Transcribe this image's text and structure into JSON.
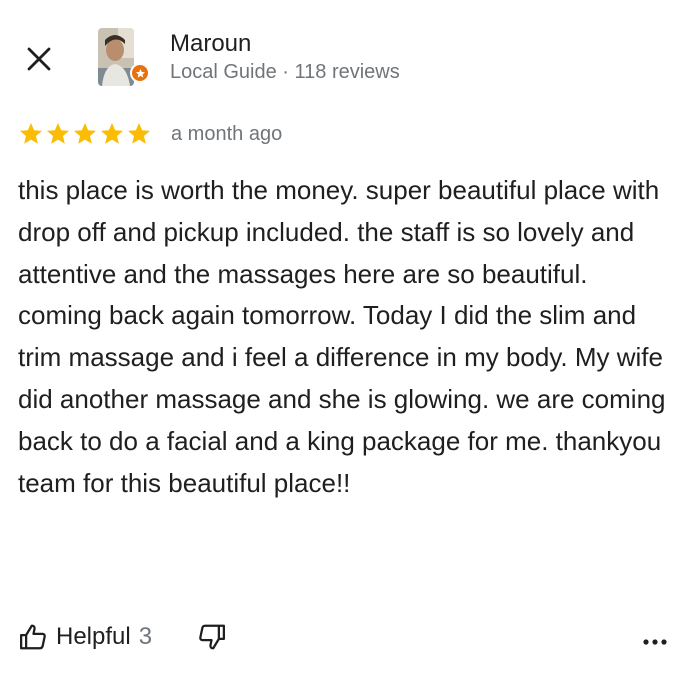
{
  "reviewer": {
    "name": "Maroun",
    "meta": "Local Guide · 118 reviews"
  },
  "review": {
    "rating": 5,
    "rating_max": 5,
    "time_ago": "a month ago",
    "text": "this place is worth the money. super beautiful place with drop off and pickup included. the staff is so lovely and attentive and the massages here are so beautiful. coming back again tomorrow. Today I did the slim and trim massage and i feel a difference in my body. My wife did another massage and she is glowing. we are coming back to do a facial and a king package for me. thankyou team for this beautiful place!!"
  },
  "actions": {
    "helpful_label": "Helpful",
    "helpful_count": "3"
  },
  "icons": {
    "close": "close-icon",
    "star": "star-icon",
    "thumbs_up": "thumbs-up-icon",
    "thumbs_down": "thumbs-down-icon",
    "more": "more-icon",
    "local_guide_badge": "local-guide-badge-icon"
  },
  "colors": {
    "star": "#fbbc04",
    "badge": "#e8710a",
    "secondary_text": "#70757a",
    "primary_text": "#1f1f1f"
  }
}
